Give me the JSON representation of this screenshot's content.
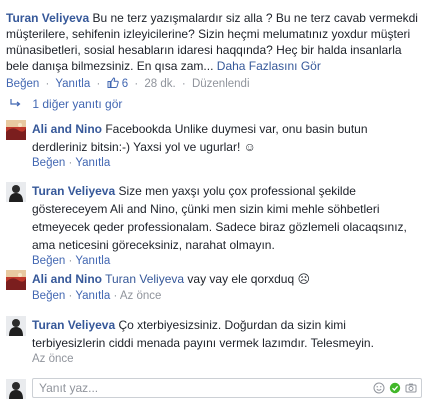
{
  "top_comment": {
    "author": "Turan Veliyeva",
    "text": "Bu ne terz yazışmalardır siz alla ? Bu ne terz cavab vermekdi müşterilere, sehifenin izleyicilerine? Sizin heçmi melumatınız yoxdur müşteri münasibetleri, sosial hesabların idaresi haqqında? Heç bir halda insanlarla bele danışa bilmezsiniz. En qısa zam...",
    "more": "Daha Fazlasını Gör",
    "like": "Beğen",
    "reply": "Yanıtla",
    "like_count": "6",
    "time": "28 dk.",
    "edited": "Düzenlendi"
  },
  "replies_toggle": "1 diğer yanıtı gör",
  "replies": [
    {
      "author": "Ali and Nino",
      "text": "Facebookda Unlike duymesi var, onu basin butun derdleriniz bitsin:-) Yaxsi yol ve ugurlar! ☺",
      "like": "Beğen",
      "reply": "Yanıtla"
    },
    {
      "author": "Turan Veliyeva",
      "text": "Size men yaxşı yolu çox professional şekilde gösterecеyem Ali and Nino, çünki men sizin kimi mehle söhbetleri etmeyecek qeder professionalam. Sadece biraz gözlemeli olacaqsınız, ama neticesini göreceksiniz, narahat olmayın.",
      "like": "Beğen",
      "reply": "Yanıtla"
    },
    {
      "author": "Ali and Nino",
      "mention": "Turan Veliyeva",
      "text": "vay vay ele qorxduq ☹",
      "like": "Beğen",
      "reply": "Yanıtla",
      "time": "Az önce"
    },
    {
      "author": "Turan Veliyeva",
      "text": "Ço xterbiyesizsiniz. Doğurdan da sizin kimi terbiyesizlerin ciddi menada payını vermek lazımdır. Telesmeyin.",
      "time": "Az önce"
    }
  ],
  "composer": {
    "placeholder": "Yanıt yaz..."
  },
  "colors": {
    "link": "#365899",
    "action": "#4267b2",
    "meta": "#90949c",
    "text": "#1d2129",
    "border": "#ccd0d5"
  },
  "icons": [
    "thumbs-up-icon",
    "reply-arrow-icon",
    "emoji-icon",
    "sticker-icon",
    "camera-icon"
  ]
}
